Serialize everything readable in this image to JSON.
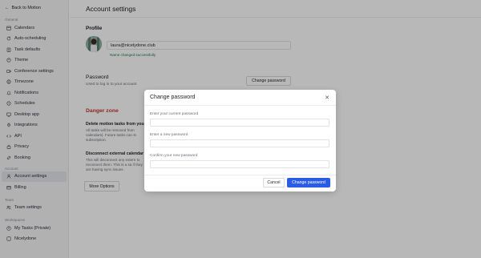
{
  "sidebar": {
    "back_label": "Back to Motion",
    "general_label": "General",
    "general_items": [
      {
        "label": "Calendars",
        "icon": "calendar-icon"
      },
      {
        "label": "Auto-scheduling",
        "icon": "refresh-icon"
      },
      {
        "label": "Task defaults",
        "icon": "clipboard-icon"
      },
      {
        "label": "Theme",
        "icon": "palette-icon"
      },
      {
        "label": "Conference settings",
        "icon": "video-icon"
      },
      {
        "label": "Timezone",
        "icon": "globe-icon"
      },
      {
        "label": "Notifications",
        "icon": "bell-icon"
      },
      {
        "label": "Schedules",
        "icon": "clock-icon"
      },
      {
        "label": "Desktop app",
        "icon": "monitor-icon"
      },
      {
        "label": "Integrations",
        "icon": "plug-icon"
      },
      {
        "label": "API",
        "icon": "code-icon"
      },
      {
        "label": "Privacy",
        "icon": "lock-icon"
      },
      {
        "label": "Booking",
        "icon": "link-icon"
      }
    ],
    "account_label": "Account",
    "account_items": [
      {
        "label": "Account settings",
        "icon": "user-icon"
      },
      {
        "label": "Billing",
        "icon": "card-icon"
      }
    ],
    "team_label": "Team",
    "team_items": [
      {
        "label": "Team settings",
        "icon": "team-icon"
      }
    ],
    "workspaces_label": "Workspaces",
    "workspace_items": [
      {
        "label": "My Tasks (Private)",
        "icon": "user-circle-icon"
      },
      {
        "label": "Nicelydone",
        "icon": "workspace-icon"
      }
    ]
  },
  "main": {
    "title": "Account settings",
    "profile_heading": "Profile",
    "email_value": "laura@nicelydone.club",
    "success_message": "Name changed successfully",
    "password_heading": "Password",
    "password_hint": "Used to log in to your account",
    "change_password_button": "Change password",
    "danger_heading": "Danger zone",
    "delete_title": "Delete motion tasks from your",
    "delete_text": "All tasks will be removed from calendars). Future tasks can st subscription.",
    "disconnect_title": "Disconnect external calendar",
    "disconnect_text": "This will disconnect any extern to reconnect them. This is a sa if they are having sync issues.",
    "more_options_button": "More Options"
  },
  "modal": {
    "title": "Change password",
    "current_label": "Enter your current password",
    "new_label": "Enter a new password",
    "confirm_label": "Confirm your new password",
    "cancel_label": "Cancel",
    "submit_label": "Change password"
  },
  "colors": {
    "accent": "#2b5ce6",
    "danger": "#c23b2f",
    "success": "#1a7f4b"
  }
}
